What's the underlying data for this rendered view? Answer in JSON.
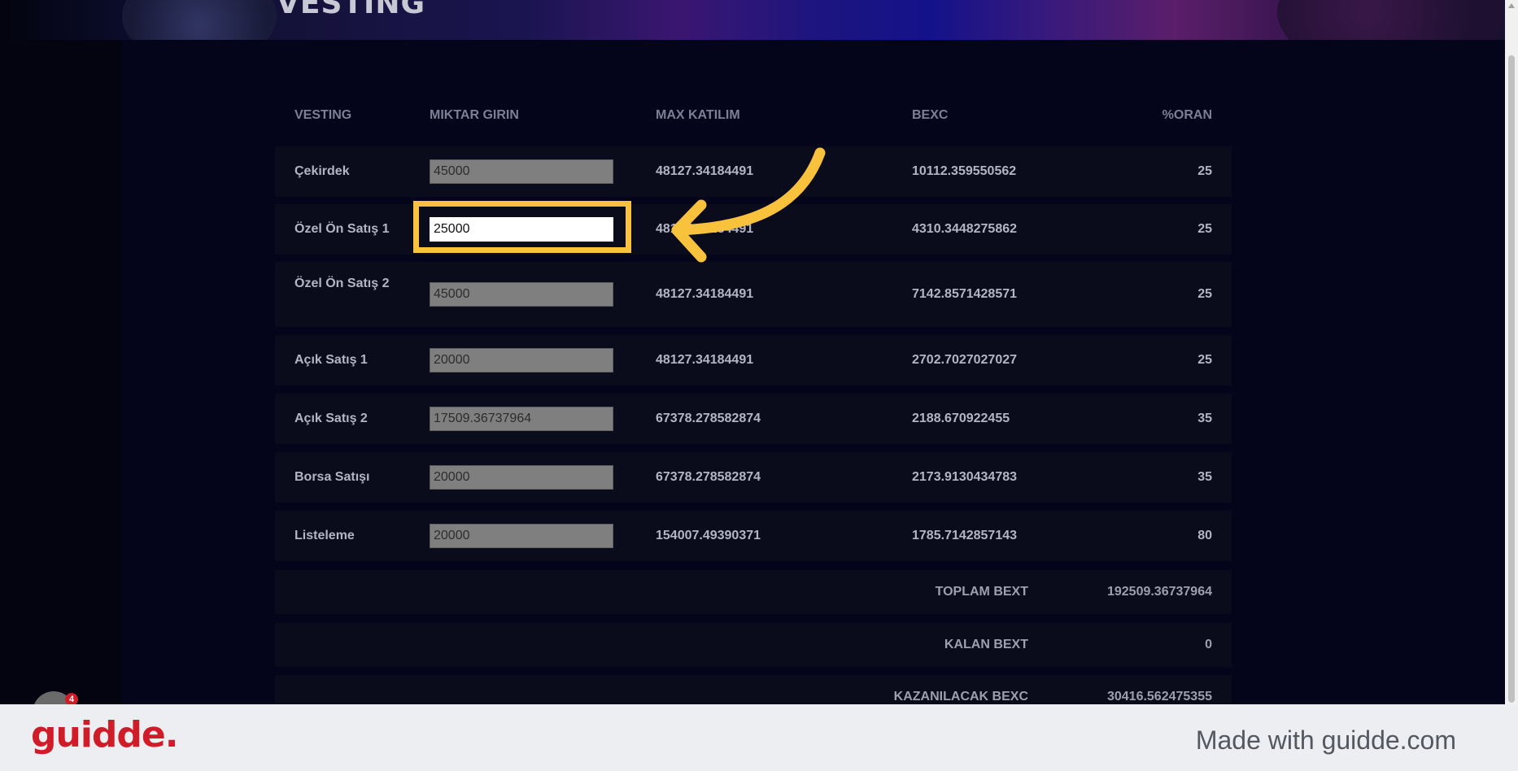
{
  "banner": {
    "title": "VESTING"
  },
  "table": {
    "headers": {
      "vesting": "VESTING",
      "amount": "MIKTAR GIRIN",
      "max": "MAX KATILIM",
      "bexc": "BEXC",
      "ratio": "%ORAN"
    },
    "rows": [
      {
        "name": "Çekirdek",
        "amount": "45000",
        "max": "48127.34184491",
        "bexc": "10112.359550562",
        "ratio": "25"
      },
      {
        "name": "Özel Ön Satış 1",
        "amount": "25000",
        "max": "48127.34184491",
        "bexc": "4310.3448275862",
        "ratio": "25"
      },
      {
        "name": "Özel Ön Satış 2",
        "amount": "45000",
        "max": "48127.34184491",
        "bexc": "7142.8571428571",
        "ratio": "25"
      },
      {
        "name": "Açık Satış 1",
        "amount": "20000",
        "max": "48127.34184491",
        "bexc": "2702.7027027027",
        "ratio": "25"
      },
      {
        "name": "Açık Satış 2",
        "amount": "17509.36737964",
        "max": "67378.278582874",
        "bexc": "2188.670922455",
        "ratio": "35"
      },
      {
        "name": "Borsa Satışı",
        "amount": "20000",
        "max": "67378.278582874",
        "bexc": "2173.9130434783",
        "ratio": "35"
      },
      {
        "name": "Listeleme",
        "amount": "20000",
        "max": "154007.49390371",
        "bexc": "1785.7142857143",
        "ratio": "80"
      }
    ],
    "summary": [
      {
        "label": "TOPLAM BEXT",
        "value": "192509.36737964"
      },
      {
        "label": "KALAN BEXT",
        "value": "0"
      },
      {
        "label": "KAZANILACAK BEXC",
        "value": "30416.562475355"
      }
    ]
  },
  "widget": {
    "badge": "4"
  },
  "footer": {
    "logo": "guidde.",
    "made_with": "Made with guidde.com"
  },
  "colors": {
    "highlight": "#f9c23c",
    "brand": "#d01b28"
  }
}
